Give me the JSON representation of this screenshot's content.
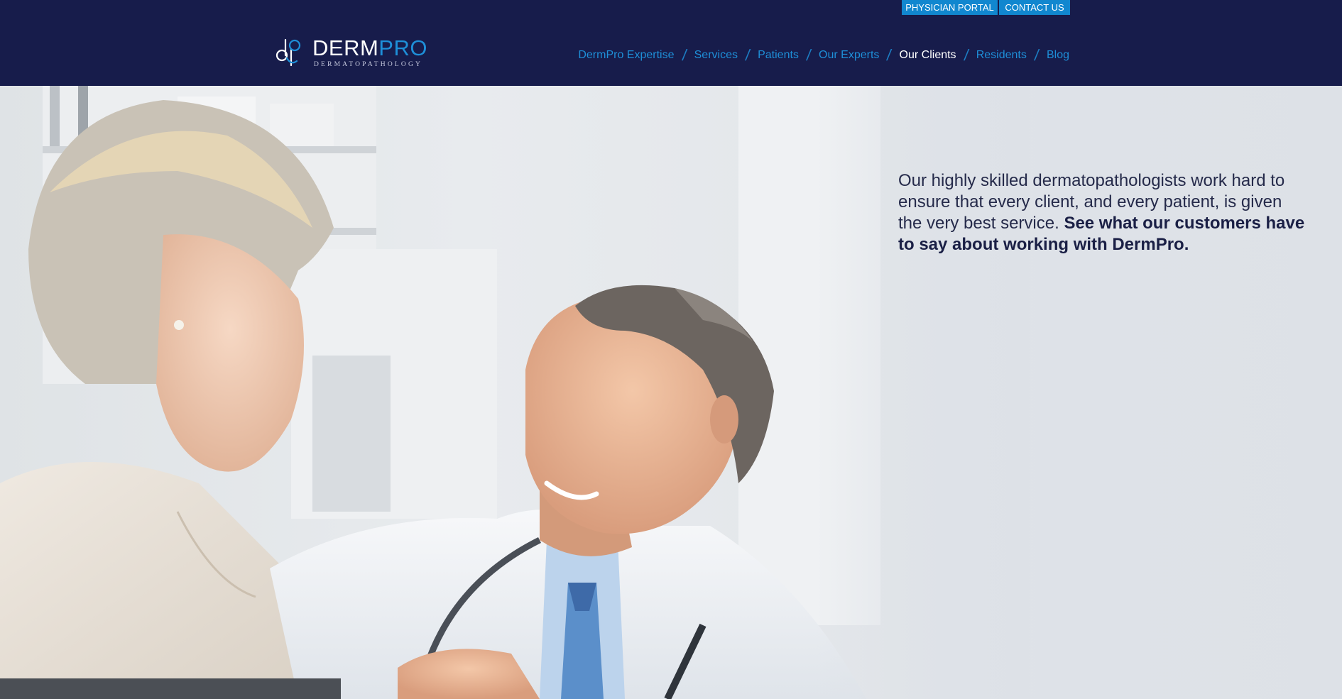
{
  "header": {
    "utility_links": {
      "portal": "PHYSICIAN PORTAL",
      "contact": "CONTACT US"
    },
    "logo": {
      "word_derm": "DERM",
      "word_pro": "PRO",
      "subtitle": "DERMATOPATHOLOGY",
      "icon": "dp-monogram-icon"
    },
    "nav": [
      {
        "label": "DermPro Expertise",
        "active": false
      },
      {
        "label": "Services",
        "active": false
      },
      {
        "label": "Patients",
        "active": false
      },
      {
        "label": "Our Experts",
        "active": false
      },
      {
        "label": "Our Clients",
        "active": true
      },
      {
        "label": "Residents",
        "active": false
      },
      {
        "label": "Blog",
        "active": false
      }
    ]
  },
  "hero": {
    "intro_text": "Our highly skilled dermatopathologists work hard to ensure that every client, and every patient, is given the very best service.",
    "emphasis_text": "See what our customers have to say about working with DermPro."
  },
  "colors": {
    "header_bg": "#171c4b",
    "accent": "#1e8fd8",
    "button_bg": "#1187cf",
    "hero_bg": "#dde1e7",
    "text_dark": "#1a1f45"
  }
}
